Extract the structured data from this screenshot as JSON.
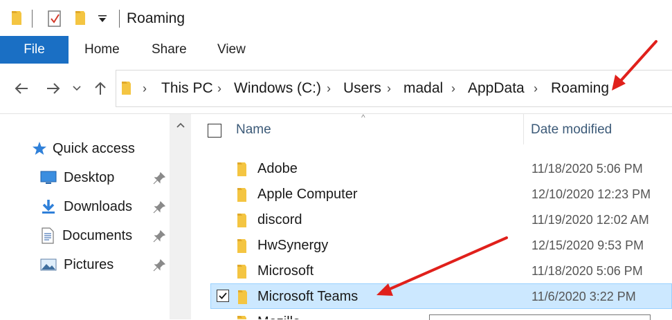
{
  "window": {
    "title": "Roaming"
  },
  "ribbon": {
    "file_label": "File",
    "tabs": [
      {
        "label": "Home"
      },
      {
        "label": "Share"
      },
      {
        "label": "View"
      }
    ]
  },
  "address_bar": {
    "crumbs": [
      "This PC",
      "Windows (C:)",
      "Users",
      "madal",
      "AppData",
      "Roaming"
    ]
  },
  "nav_pane": {
    "quick_access_label": "Quick access",
    "items": [
      {
        "label": "Desktop",
        "icon": "desktop-icon"
      },
      {
        "label": "Downloads",
        "icon": "downloads-icon"
      },
      {
        "label": "Documents",
        "icon": "documents-icon"
      },
      {
        "label": "Pictures",
        "icon": "pictures-icon"
      }
    ]
  },
  "file_list": {
    "columns": {
      "name": "Name",
      "date_modified": "Date modified"
    },
    "rows": [
      {
        "name": "Adobe",
        "date": "11/18/2020 5:06 PM"
      },
      {
        "name": "Apple Computer",
        "date": "12/10/2020 12:23 PM"
      },
      {
        "name": "discord",
        "date": "11/19/2020 12:02 AM"
      },
      {
        "name": "HwSynergy",
        "date": "12/15/2020 9:53 PM"
      },
      {
        "name": "Microsoft",
        "date": "11/18/2020 5:06 PM"
      },
      {
        "name": "Microsoft Teams",
        "date": "11/6/2020 3:22 PM",
        "selected": true
      },
      {
        "name": "Mozilla",
        "date": ""
      }
    ]
  },
  "colors": {
    "accent": "#1a6fc4",
    "selection": "#cce8ff",
    "annotation_arrow": "#e0201b",
    "folder": "#f4c542"
  }
}
